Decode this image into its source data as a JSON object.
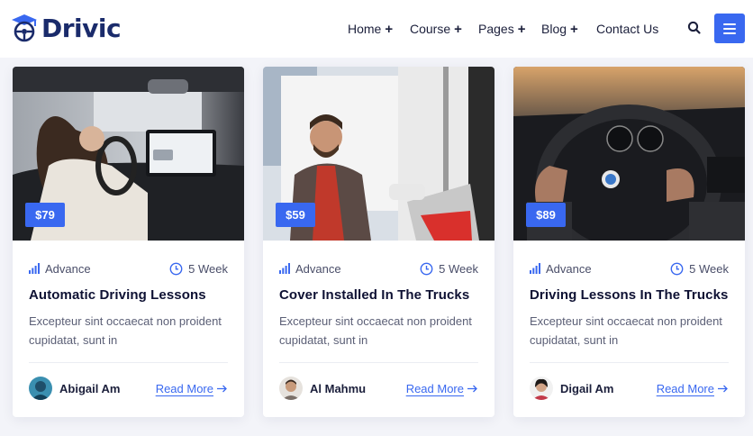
{
  "brand": {
    "name": "Drivic",
    "accent": "#3968f0",
    "logo_color": "#1a2b6b"
  },
  "nav": {
    "items": [
      {
        "label": "Home",
        "has_submenu": true
      },
      {
        "label": "Course",
        "has_submenu": true
      },
      {
        "label": "Pages",
        "has_submenu": true
      },
      {
        "label": "Blog",
        "has_submenu": true
      },
      {
        "label": "Contact Us",
        "has_submenu": false
      }
    ],
    "plus_glyph": "+",
    "search_icon": "search-icon",
    "menu_icon": "hamburger-icon"
  },
  "cards": [
    {
      "price": "$79",
      "level": "Advance",
      "duration": "5 Week",
      "title": "Automatic Driving Lessons",
      "description": "Excepteur sint occaecat non proident cupidatat, sunt in",
      "author": "Abigail Am",
      "read_more": "Read More"
    },
    {
      "price": "$59",
      "level": "Advance",
      "duration": "5 Week",
      "title": "Cover Installed In The Trucks",
      "description": "Excepteur sint occaecat non proident cupidatat, sunt in",
      "author": "Al Mahmu",
      "read_more": "Read More"
    },
    {
      "price": "$89",
      "level": "Advance",
      "duration": "5 Week",
      "title": "Driving Lessons In The Trucks",
      "description": "Excepteur sint occaecat non proident cupidatat, sunt in",
      "author": "Digail Am",
      "read_more": "Read More"
    }
  ]
}
